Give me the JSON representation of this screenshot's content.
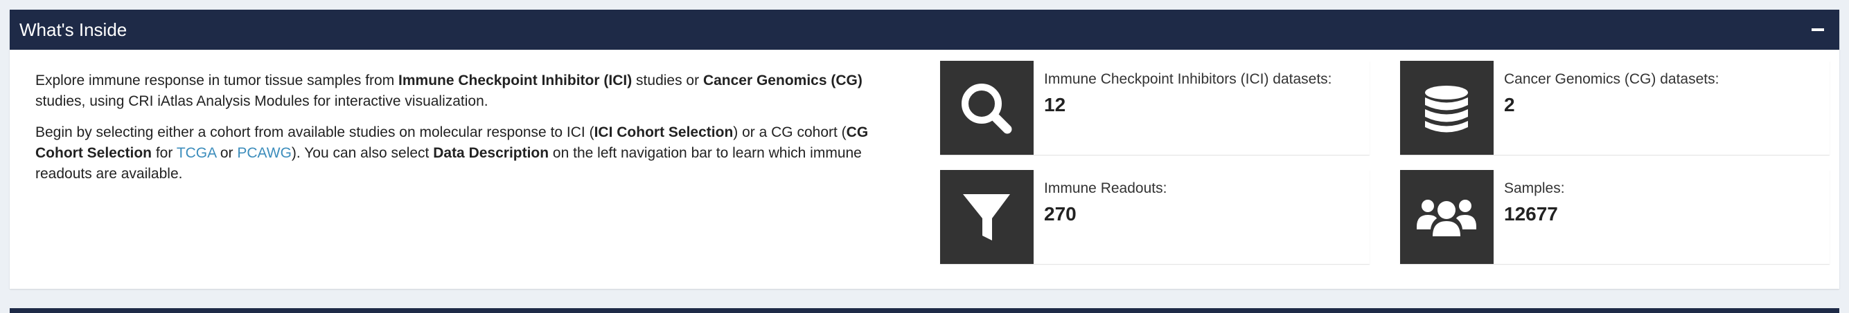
{
  "header": {
    "title": "What's Inside",
    "collapse_label": "−"
  },
  "intro": {
    "p1": {
      "t1": "Explore immune response in tumor tissue samples from ",
      "b1": "Immune Checkpoint Inhibitor (ICI)",
      "t2": " studies or ",
      "b2": "Cancer Genomics (CG)",
      "t3": " studies, using CRI iAtlas Analysis Modules for interactive visualization."
    },
    "p2": {
      "t1": "Begin by selecting either a cohort from available studies on molecular response to ICI (",
      "b1": "ICI Cohort Selection",
      "t2": ") or a CG cohort (",
      "b2": "CG Cohort Selection",
      "t3": " for ",
      "link1": "TCGA",
      "t4": " or ",
      "link2": "PCAWG",
      "t5": "). You can also select ",
      "b3": "Data Description",
      "t6": " on the left navigation bar to learn which immune readouts are available."
    }
  },
  "info_boxes": [
    {
      "icon": "search-icon",
      "label": "Immune Checkpoint Inhibitors (ICI) datasets:",
      "value": "12"
    },
    {
      "icon": "database-icon",
      "label": "Cancer Genomics (CG) datasets:",
      "value": "2"
    },
    {
      "icon": "filter-icon",
      "label": "Immune Readouts:",
      "value": "270"
    },
    {
      "icon": "users-icon",
      "label": "Samples:",
      "value": "12677"
    }
  ],
  "colors": {
    "header_bg": "#1e2a47",
    "icon_bg": "#333333",
    "link": "#3c8dbc"
  }
}
